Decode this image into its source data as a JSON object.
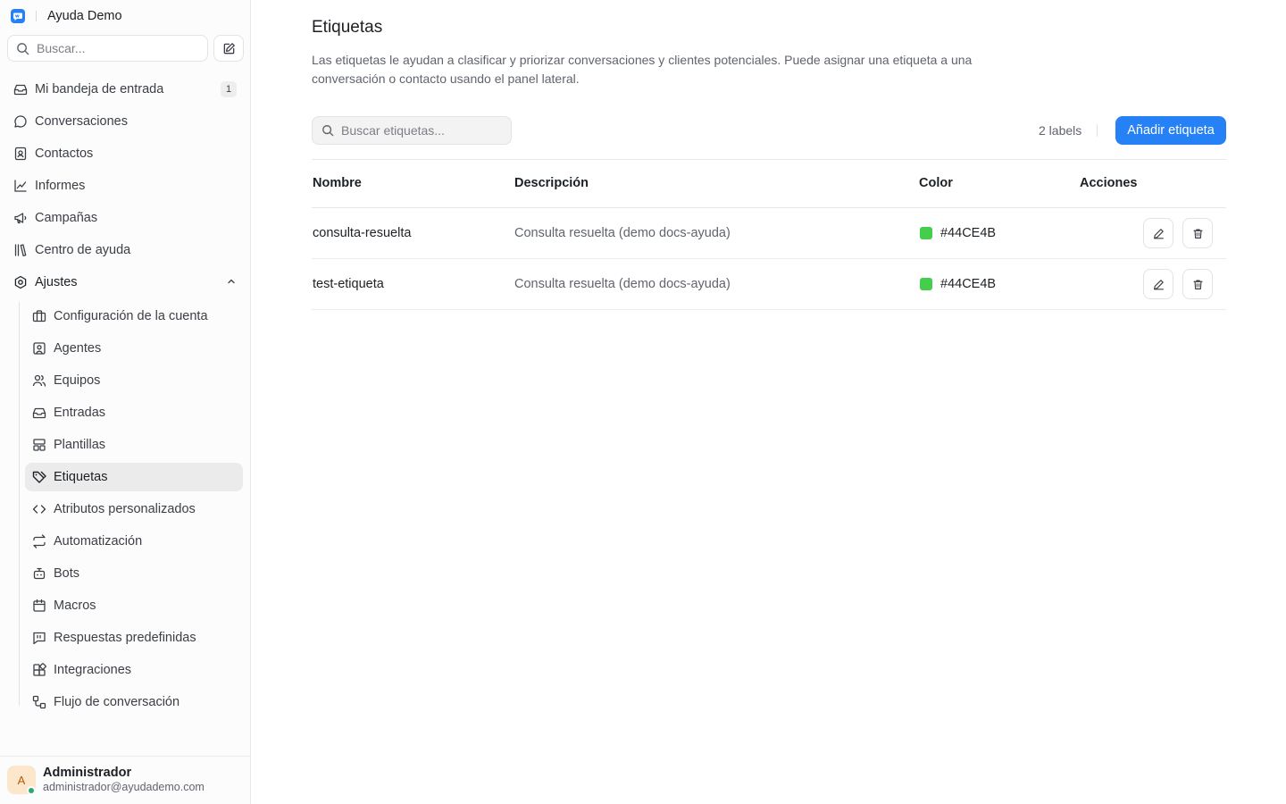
{
  "brand": {
    "name": "Ayuda Demo"
  },
  "sidebar": {
    "search_placeholder": "Buscar...",
    "nav": [
      {
        "label": "Mi bandeja de entrada",
        "icon": "inbox-icon",
        "badge": "1"
      },
      {
        "label": "Conversaciones",
        "icon": "chat-bubble-icon"
      },
      {
        "label": "Contactos",
        "icon": "contact-book-icon"
      },
      {
        "label": "Informes",
        "icon": "chart-line-icon"
      },
      {
        "label": "Campañas",
        "icon": "megaphone-icon"
      },
      {
        "label": "Centro de ayuda",
        "icon": "library-icon"
      },
      {
        "label": "Ajustes",
        "icon": "settings-gear-icon"
      }
    ],
    "settings_items": [
      {
        "label": "Configuración de la cuenta",
        "icon": "briefcase-icon"
      },
      {
        "label": "Agentes",
        "icon": "user-square-icon"
      },
      {
        "label": "Equipos",
        "icon": "users-icon"
      },
      {
        "label": "Entradas",
        "icon": "inbox-icon"
      },
      {
        "label": "Plantillas",
        "icon": "layout-template-icon"
      },
      {
        "label": "Etiquetas",
        "icon": "tags-icon",
        "active": true
      },
      {
        "label": "Atributos personalizados",
        "icon": "code-icon"
      },
      {
        "label": "Automatización",
        "icon": "arrows-swap-icon"
      },
      {
        "label": "Bots",
        "icon": "bot-icon"
      },
      {
        "label": "Macros",
        "icon": "calendar-icon"
      },
      {
        "label": "Respuestas predefinidas",
        "icon": "quote-message-icon"
      },
      {
        "label": "Integraciones",
        "icon": "blocks-icon"
      },
      {
        "label": "Flujo de conversación",
        "icon": "workflow-icon"
      }
    ],
    "user": {
      "initial": "A",
      "name": "Administrador",
      "email": "administrador@ayudademo.com"
    }
  },
  "main": {
    "title": "Etiquetas",
    "description": "Las etiquetas le ayudan a clasificar y priorizar conversaciones y clientes potenciales. Puede asignar una etiqueta a una conversación o contacto usando el panel lateral.",
    "search_placeholder": "Buscar etiquetas...",
    "count_label": "2 labels",
    "add_button": "Añadir etiqueta",
    "columns": [
      "Nombre",
      "Descripción",
      "Color",
      "Acciones"
    ],
    "rows": [
      {
        "name": "consulta-resuelta",
        "description": "Consulta resuelta (demo docs-ayuda)",
        "color": "#44CE4B"
      },
      {
        "name": "test-etiqueta",
        "description": "Consulta resuelta (demo docs-ayuda)",
        "color": "#44CE4B"
      }
    ]
  },
  "colors": {
    "accent": "#2781f6",
    "swatch": "#44CE4B",
    "online": "#2aa772"
  }
}
